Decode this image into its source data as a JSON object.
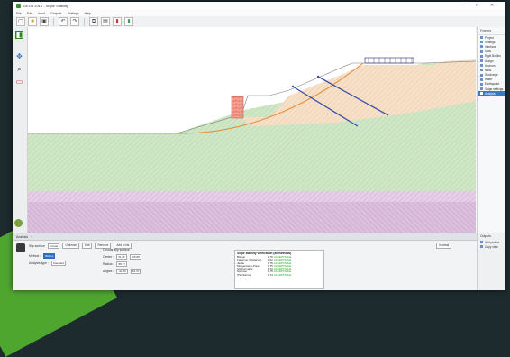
{
  "app": {
    "title": "GEO5 2018 - Slope Stability",
    "window_controls": [
      "–",
      "□",
      "✕"
    ]
  },
  "menu": [
    "File",
    "Edit",
    "Input",
    "Outputs",
    "Settings",
    "Help"
  ],
  "toolbar": {
    "icons": [
      "new-file-icon",
      "open-folder-icon",
      "save-icon",
      "undo-icon",
      "redo-icon",
      "copy-icon",
      "paste-icon",
      "chart-icon",
      "color-icon"
    ]
  },
  "left_tools": [
    "select-icon",
    "move-icon",
    "zoom-icon",
    "frame-icon"
  ],
  "right_panel": {
    "title": "Frames",
    "items": [
      {
        "label": "Project",
        "active": false
      },
      {
        "label": "Settings",
        "active": false
      },
      {
        "label": "Interface",
        "active": false
      },
      {
        "label": "Soils",
        "active": false
      },
      {
        "label": "Rigid Bodies",
        "active": false
      },
      {
        "label": "Assign",
        "active": false
      },
      {
        "label": "Anchors",
        "active": false
      },
      {
        "label": "Nails",
        "active": false
      },
      {
        "label": "Surcharge",
        "active": false
      },
      {
        "label": "Water",
        "active": false
      },
      {
        "label": "Earthquake",
        "active": false
      },
      {
        "label": "Stage settings",
        "active": false
      },
      {
        "label": "Analysis",
        "active": true
      }
    ]
  },
  "bottom": {
    "tab_label": "Analysis",
    "slip_surface_label": "Slip surface",
    "analysis_method_value": "circular",
    "buttons": [
      "Optimize",
      "Edit",
      "Remove",
      "Add to list"
    ],
    "method_label": "Method :",
    "method_value": "Bishop",
    "analysis_type_label": "Analysis type :",
    "analysis_type_value": "Standard",
    "slip_circle_title": "Circular slip surface",
    "fields": [
      {
        "label": "Center :",
        "x": "31.25",
        "z": "165.88"
      },
      {
        "label": "Radius :",
        "value": "88.77"
      },
      {
        "label": "Angles :",
        "a1": "-41.80",
        "a2": "64.70"
      }
    ],
    "results_title": "Slope stability verification (all methods)",
    "results": [
      {
        "method": "Bishop",
        "fs": "1.76",
        "status": "ACCEPTABLE"
      },
      {
        "method": "Fellenius / Petterson",
        "fs": "1.62",
        "status": "ACCEPTABLE"
      },
      {
        "method": "Janbu",
        "fs": "1.75",
        "status": "ACCEPTABLE"
      },
      {
        "method": "Morgenstern-Price",
        "fs": "1.75",
        "status": "ACCEPTABLE"
      },
      {
        "method": "Shahunyants",
        "fs": "1.72",
        "status": "ACCEPTABLE"
      },
      {
        "method": "Spencer",
        "fs": "1.75",
        "status": "ACCEPTABLE"
      },
      {
        "method": "ITF (Sarma)",
        "fs": "1.74",
        "status": "ACCEPTABLE"
      }
    ],
    "details_label": "In detail",
    "add_graph_label": "Add picture"
  },
  "output_panel": {
    "title": "Outputs",
    "items": [
      "Add picture",
      "Copy view"
    ]
  },
  "colors": {
    "clay_orange": "#f5dcc3",
    "soil_green": "#cfe7c6",
    "purple": "#d6b4d8",
    "anchor_blue": "#3a4fa8",
    "slip_orange": "#e08a3a",
    "wall_red": "#e36a5a"
  }
}
